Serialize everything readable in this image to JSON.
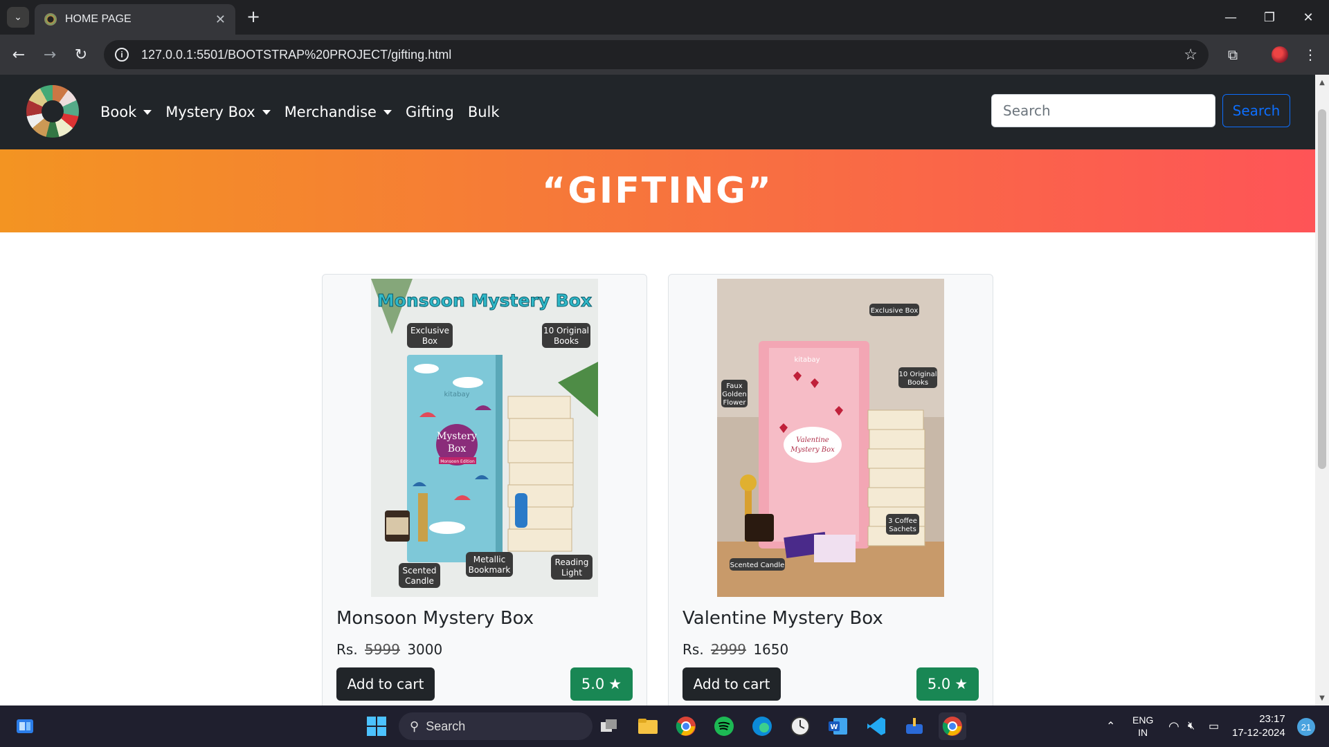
{
  "browser": {
    "tab_title": "HOME PAGE",
    "url": "127.0.0.1:5501/BOOTSTRAP%20PROJECT/gifting.html"
  },
  "navbar": {
    "links": [
      {
        "label": "Book",
        "dropdown": true
      },
      {
        "label": "Mystery Box",
        "dropdown": true
      },
      {
        "label": "Merchandise",
        "dropdown": true
      },
      {
        "label": "Gifting",
        "dropdown": false
      },
      {
        "label": "Bulk",
        "dropdown": false
      }
    ],
    "search_placeholder": "Search",
    "search_button": "Search"
  },
  "banner": {
    "title": "“GIFTING”"
  },
  "products": [
    {
      "name": "Monsoon Mystery Box",
      "currency": "Rs.",
      "old_price": "5999",
      "price": "3000",
      "cart_label": "Add to cart",
      "rating": "5.0",
      "image": {
        "heading": "Monsoon Mystery Box",
        "box_title": "Mystery Box",
        "box_sub": "Monsoon Edition",
        "brand": "kitabay",
        "labels": [
          "Exclusive Box",
          "10 Original Books",
          "Scented Candle",
          "Metallic Bookmark",
          "Reading Light"
        ]
      }
    },
    {
      "name": "Valentine Mystery Box",
      "currency": "Rs.",
      "old_price": "2999",
      "price": "1650",
      "cart_label": "Add to cart",
      "rating": "5.0",
      "image": {
        "box_title": "Valentine Mystery Box",
        "brand": "kitabay",
        "labels": [
          "Exclusive Box",
          "10 Original Books",
          "Faux Golden Flower",
          "3 Coffee Sachets",
          "Scented Candle"
        ]
      }
    }
  ],
  "taskbar": {
    "search_label": "Search",
    "lang": "ENG",
    "region": "IN",
    "time": "23:17",
    "date": "17-12-2024",
    "notifications": "21"
  },
  "colors": {
    "navbar_bg": "#212529",
    "banner_start": "#f39422",
    "banner_end": "#fe5457",
    "search_btn": "#0d6efd",
    "rating_bg": "#198754"
  }
}
